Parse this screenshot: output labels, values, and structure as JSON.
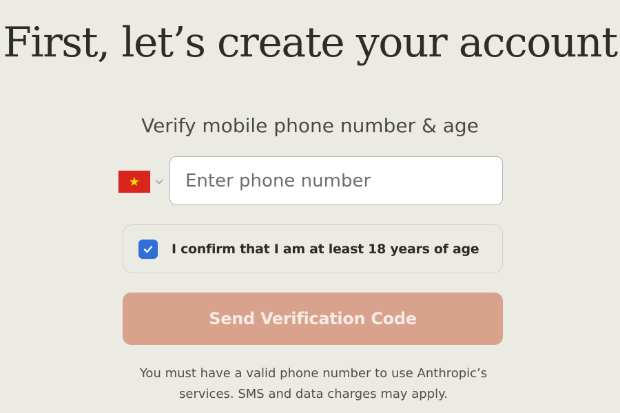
{
  "header": {
    "title": "First, let’s create your account"
  },
  "form": {
    "subtitle": "Verify mobile phone number & age",
    "country": {
      "flag_icon": "vietnam-flag-icon",
      "flag_colors": {
        "background": "#da251d",
        "star": "#ffde00"
      },
      "chevron_icon": "chevron-down-icon"
    },
    "phone": {
      "value": "",
      "placeholder": "Enter phone number"
    },
    "age_confirm": {
      "checked": true,
      "label": "I confirm that I am at least 18 years of age"
    },
    "send_button_label": "Send Verification Code",
    "disclaimer_line1": "You must have a valid phone number to use Anthropic’s",
    "disclaimer_line2": "services. SMS and data charges may apply."
  },
  "colors": {
    "page_background": "#ecebe3",
    "button_background": "#d9a28c",
    "checkbox_accent": "#2f6fd6"
  }
}
